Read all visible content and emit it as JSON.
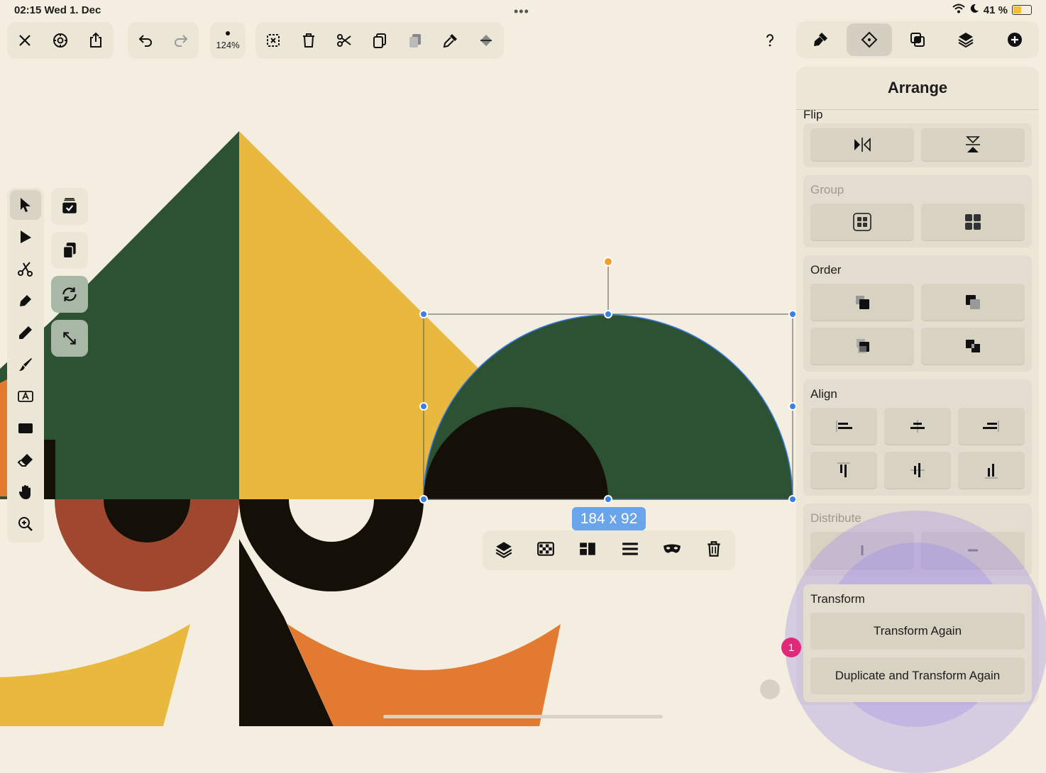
{
  "status": {
    "time_date": "02:15  Wed 1. Dec",
    "battery_text": "41 %",
    "battery_level": 0.41
  },
  "toolbar": {
    "zoom_label": "124%"
  },
  "selection": {
    "size_label": "184 x 92"
  },
  "panel": {
    "title": "Arrange",
    "sections": {
      "flip": "Flip",
      "group": "Group",
      "order": "Order",
      "align": "Align",
      "distribute": "Distribute",
      "transform": "Transform"
    },
    "transform_again_label": "Transform Again",
    "duplicate_transform_label": "Duplicate and Transform Again"
  },
  "badge_count": "1",
  "colors": {
    "canvas_bg": "#f3eee0",
    "dark_green": "#2d5133",
    "mustard": "#e9b83e",
    "rust": "#a0472f",
    "orange": "#e27a32",
    "black": "#141008",
    "selection_blue": "#3a7fe6",
    "rotate_handle": "#f0a030",
    "badge_pink": "#e0297a"
  }
}
